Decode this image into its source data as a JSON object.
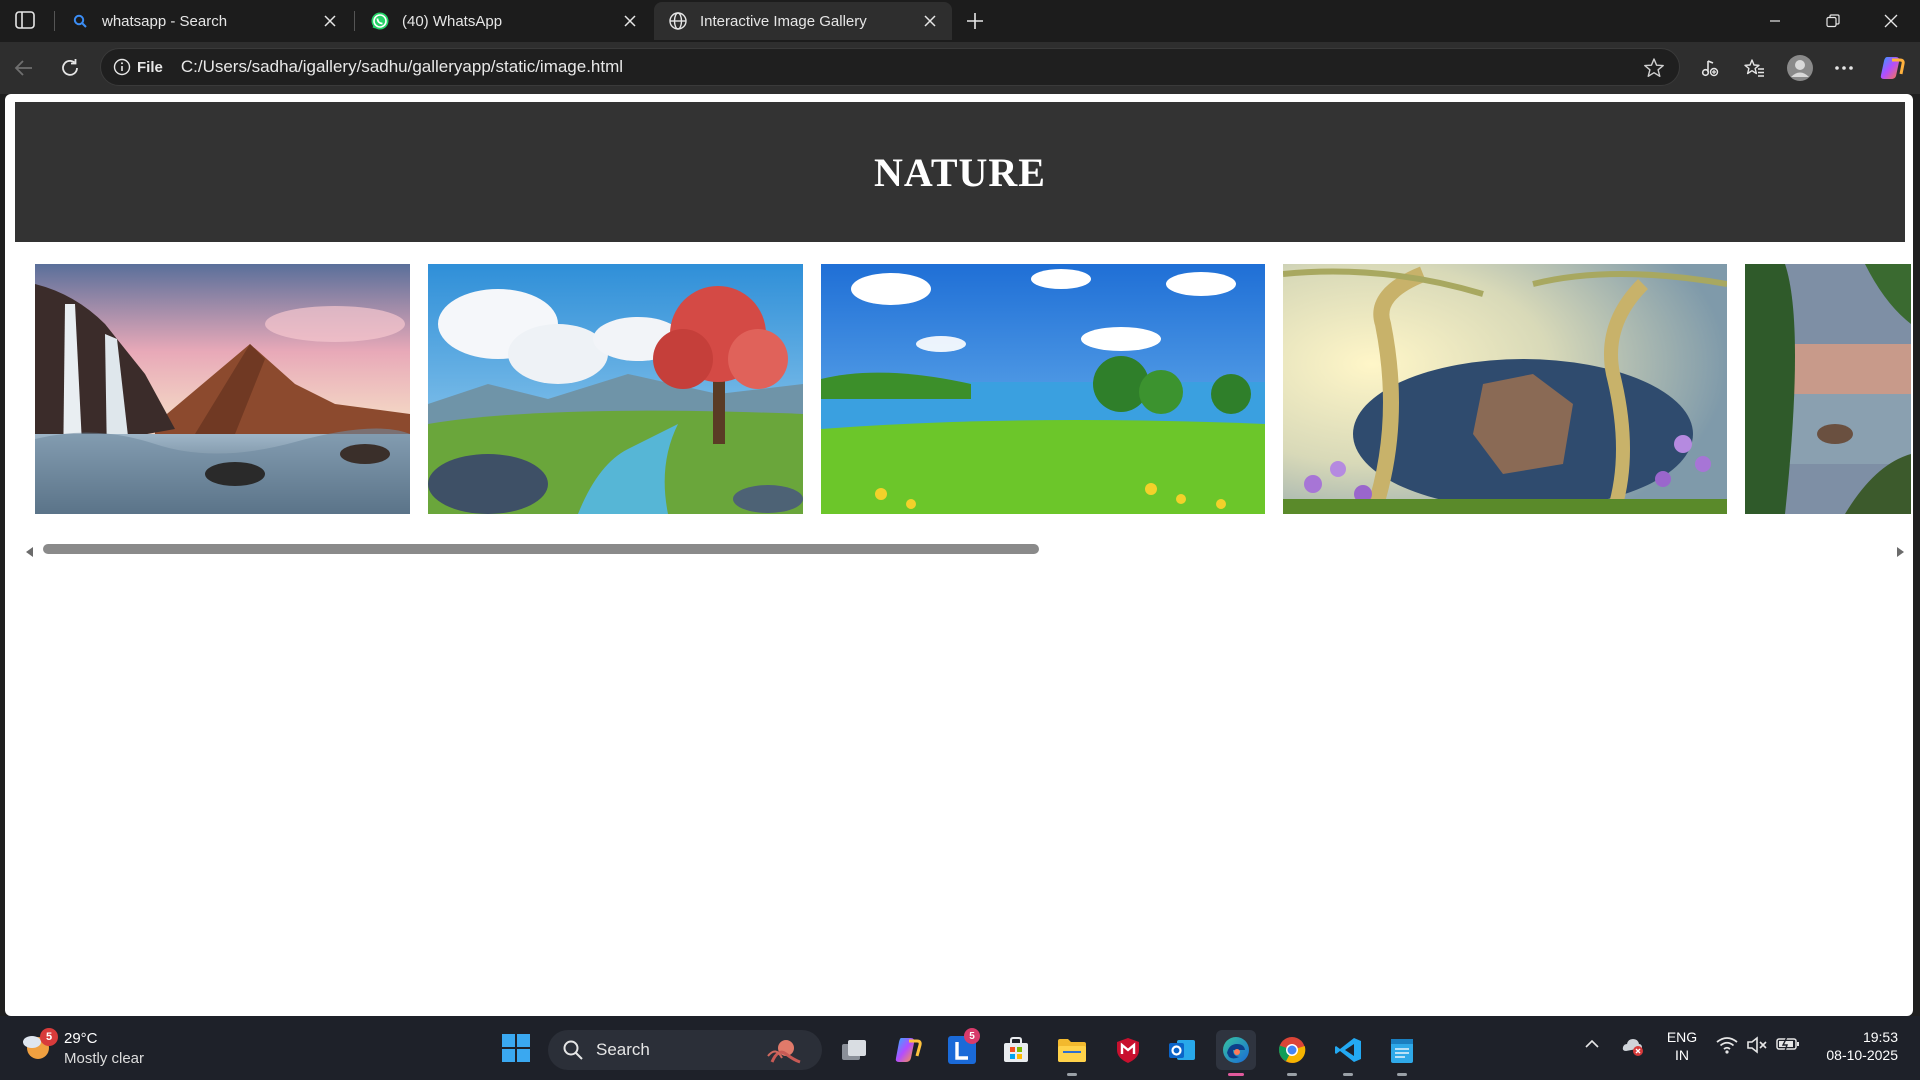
{
  "browser": {
    "tabs": [
      {
        "title": "whatsapp - Search",
        "icon": "search-icon",
        "active": false
      },
      {
        "title": "(40) WhatsApp",
        "icon": "whatsapp-icon",
        "active": false
      },
      {
        "title": "Interactive Image Gallery",
        "icon": "globe-icon",
        "active": true
      }
    ],
    "address": {
      "scheme_label": "File",
      "url": "C:/Users/sadha/igallery/sadhu/galleryapp/static/image.html"
    }
  },
  "page": {
    "title": "NATURE",
    "header_bg": "#333333",
    "images": [
      {
        "name": "waterfall-mountain"
      },
      {
        "name": "red-tree-meadow"
      },
      {
        "name": "lake-green-field"
      },
      {
        "name": "golden-trees-rock"
      },
      {
        "name": "forest-lake-partial"
      }
    ],
    "scroll_fraction": 0.54
  },
  "taskbar": {
    "weather": {
      "temp": "29°C",
      "condition": "Mostly clear",
      "badge": "5"
    },
    "search_label": "Search",
    "apps": [
      {
        "name": "task-view"
      },
      {
        "name": "copilot"
      },
      {
        "name": "linkedin",
        "badge": "5"
      },
      {
        "name": "microsoft-store"
      },
      {
        "name": "file-explorer"
      },
      {
        "name": "mcafee"
      },
      {
        "name": "outlook"
      },
      {
        "name": "edge",
        "active": true
      },
      {
        "name": "chrome"
      },
      {
        "name": "vscode"
      },
      {
        "name": "notepad"
      }
    ],
    "lang": {
      "line1": "ENG",
      "line2": "IN"
    },
    "clock": {
      "time": "19:53",
      "date": "08-10-2025"
    }
  }
}
